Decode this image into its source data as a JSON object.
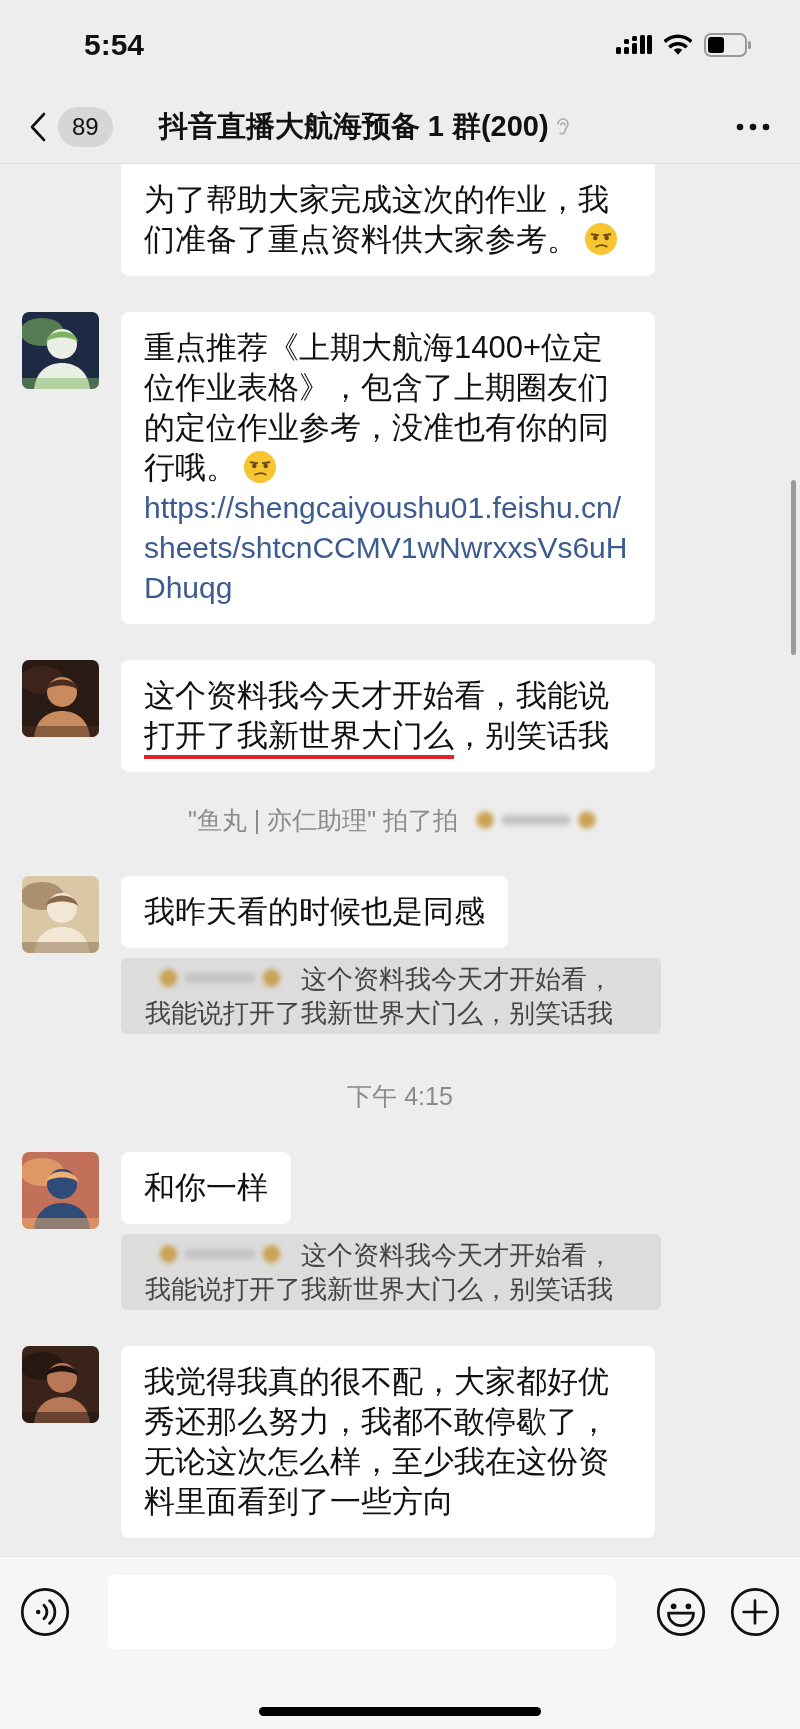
{
  "status_bar": {
    "time": "5:54"
  },
  "header": {
    "unread_count": "89",
    "title": "抖音直播大航海预备 1 群(200)"
  },
  "messages": [
    {
      "kind": "bubble",
      "segments": [
        {
          "kind": "text",
          "text": "为了帮助大家完成这次的作业，我们准备了重点资料供大家参考。"
        },
        {
          "kind": "emoji"
        }
      ]
    },
    {
      "kind": "bubble",
      "avatar": {
        "kind": "picture"
      },
      "segments": [
        {
          "kind": "text",
          "text": "重点推荐《上期大航海1400+位定位作业表格》，包含了上期圈友们的定位作业参考，没准也有你的同行哦。"
        },
        {
          "kind": "emoji"
        },
        {
          "kind": "link",
          "text": "https://shengcaiyoushu01.feishu.cn/sheets/shtcnCCMV1wNwrxxsVs6uHDhuqg"
        }
      ]
    },
    {
      "kind": "bubble",
      "avatar": {
        "kind": "picture"
      },
      "segments": [
        {
          "kind": "text",
          "parts": [
            {
              "text": "这个资料我今天才开始看，我能说",
              "underlined": false
            },
            {
              "text": "打开了我新世界大门么",
              "underlined": true
            },
            {
              "text": "，别笑话我",
              "underlined": false
            }
          ]
        }
      ]
    },
    {
      "kind": "system",
      "text": "\"鱼丸 | 亦仁助理\" 拍了拍",
      "redacted_name": true
    },
    {
      "kind": "bubble",
      "avatar": {
        "kind": "picture"
      },
      "segments": [
        {
          "kind": "text",
          "text": "我昨天看的时候也是同感"
        }
      ],
      "quote": {
        "redacted_name": true,
        "text": "这个资料我今天才开始看，我能说打开了我新世界大门么，别笑话我"
      }
    },
    {
      "kind": "time",
      "text": "下午 4:15"
    },
    {
      "kind": "bubble",
      "avatar": {
        "kind": "picture"
      },
      "segments": [
        {
          "kind": "text",
          "text": "和你一样"
        }
      ],
      "quote": {
        "redacted_name": true,
        "text": "这个资料我今天才开始看，我能说打开了我新世界大门么，别笑话我"
      }
    },
    {
      "kind": "bubble",
      "avatar": {
        "kind": "picture"
      },
      "segments": [
        {
          "kind": "text",
          "text": "我觉得我真的很不配，大家都好优秀还那么努力，我都不敢停歇了，无论这次怎么样，至少我在这份资料里面看到了一些方向"
        }
      ]
    }
  ]
}
